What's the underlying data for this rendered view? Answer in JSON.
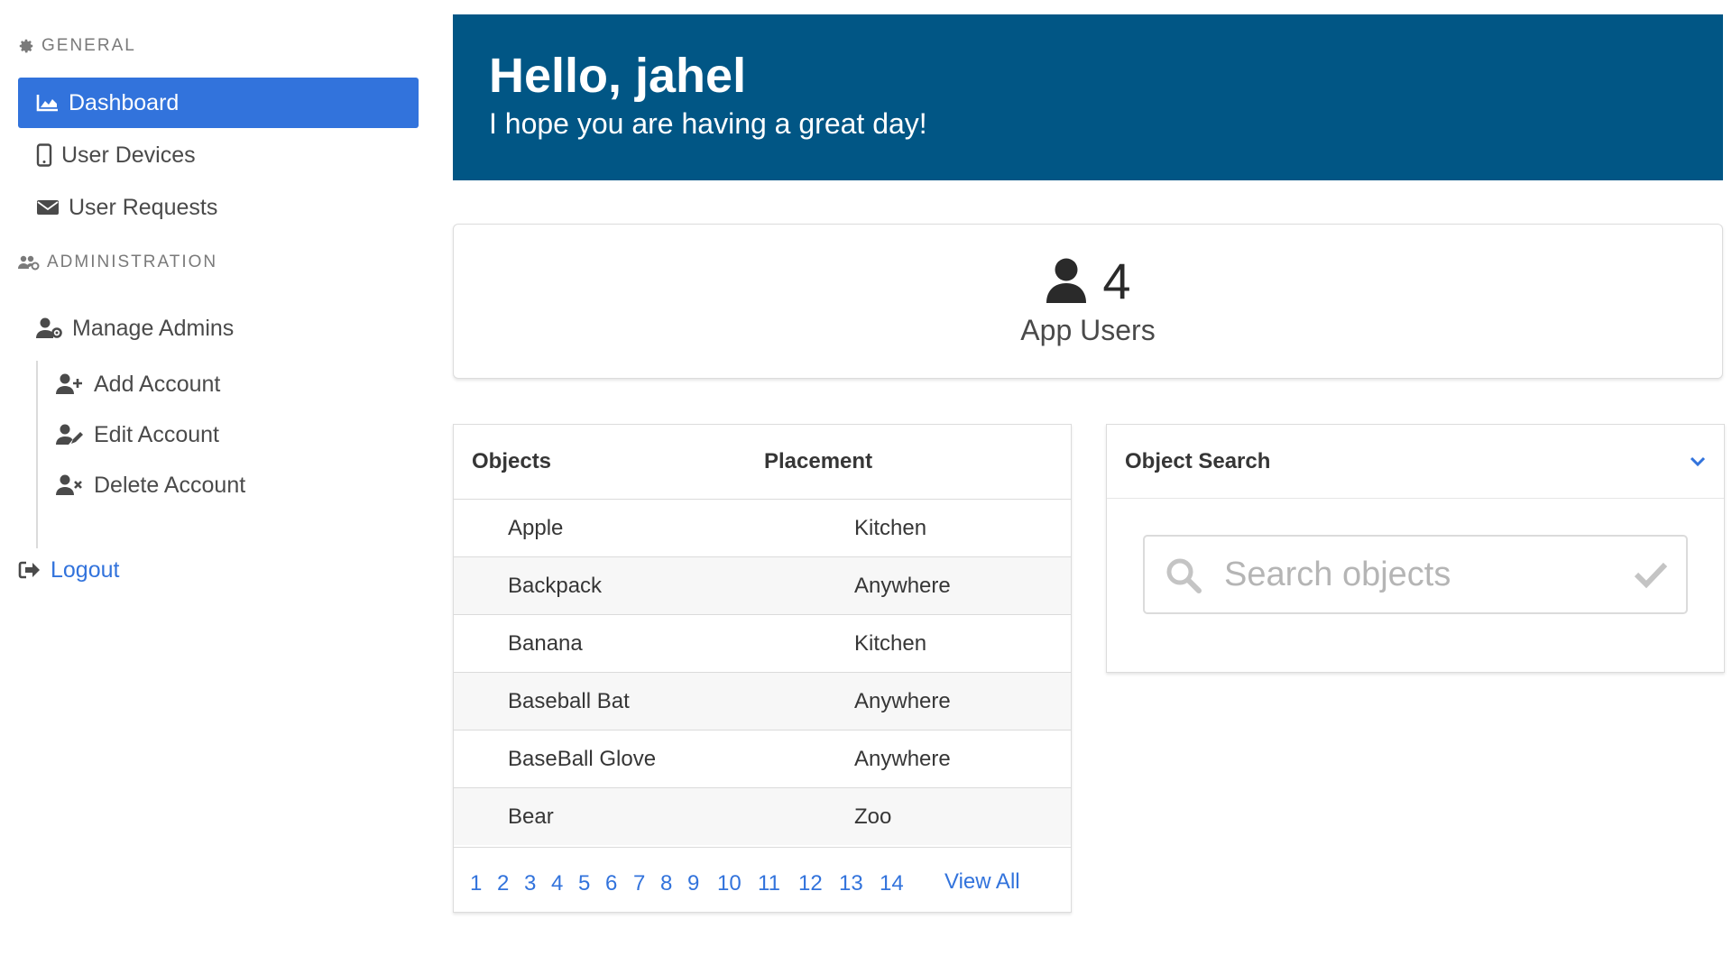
{
  "sidebar": {
    "general_label": "General",
    "admin_label": "Administration",
    "items": [
      {
        "label": "Dashboard",
        "icon": "chart-area-icon"
      },
      {
        "label": "User Devices",
        "icon": "mobile-icon"
      },
      {
        "label": "User Requests",
        "icon": "envelope-icon"
      }
    ],
    "manage_admins": {
      "label": "Manage Admins",
      "icon": "user-cog-icon"
    },
    "sub_items": [
      {
        "label": "Add Account",
        "icon": "user-plus-icon"
      },
      {
        "label": "Edit Account",
        "icon": "user-edit-icon"
      },
      {
        "label": "Delete Account",
        "icon": "user-times-icon"
      }
    ],
    "logout_label": "Logout"
  },
  "hero": {
    "title": "Hello, jahel",
    "subtitle": "I hope you are having a great day!"
  },
  "stats": {
    "value": "4",
    "label": "App Users",
    "icon": "user-icon"
  },
  "objects_table": {
    "headers": [
      "Objects",
      "Placement"
    ],
    "rows": [
      {
        "object": "Apple",
        "placement": "Kitchen"
      },
      {
        "object": "Backpack",
        "placement": "Anywhere"
      },
      {
        "object": "Banana",
        "placement": "Kitchen"
      },
      {
        "object": "Baseball Bat",
        "placement": "Anywhere"
      },
      {
        "object": "BaseBall Glove",
        "placement": "Anywhere"
      },
      {
        "object": "Bear",
        "placement": "Zoo"
      }
    ],
    "pages": [
      "1",
      "2",
      "3",
      "4",
      "5",
      "6",
      "7",
      "8",
      "9",
      "10",
      "11",
      "12",
      "13",
      "14"
    ],
    "view_all": "View All"
  },
  "object_search": {
    "title": "Object Search",
    "placeholder": "Search objects"
  },
  "colors": {
    "primary": "#3273dc",
    "hero_bg": "#015685",
    "text": "#363636"
  }
}
